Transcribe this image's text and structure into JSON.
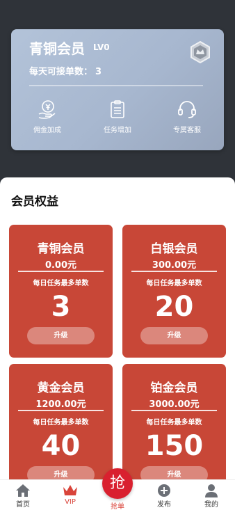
{
  "member": {
    "title": "青铜会员",
    "level": "LV0",
    "orders_label": "每天可接单数：",
    "orders_value": "3",
    "features": [
      {
        "icon": "coin-hand-icon",
        "label": "佣金加成"
      },
      {
        "icon": "clipboard-icon",
        "label": "任务增加"
      },
      {
        "icon": "headset-icon",
        "label": "专属客服"
      }
    ]
  },
  "benefits": {
    "title": "会员权益",
    "cap_label": "每日任务最多单数",
    "upgrade_label": "升级",
    "tiers": [
      {
        "name": "青铜会员",
        "price": "0.00元",
        "count": "3"
      },
      {
        "name": "白银会员",
        "price": "300.00元",
        "count": "20"
      },
      {
        "name": "黄金会员",
        "price": "1200.00元",
        "count": "40"
      },
      {
        "name": "铂金会员",
        "price": "3000.00元",
        "count": "150"
      }
    ]
  },
  "tabbar": {
    "home": "首页",
    "vip": "VIP",
    "grab_glyph": "抢",
    "grab": "抢单",
    "publish": "发布",
    "mine": "我的"
  },
  "colors": {
    "accent": "#c84737",
    "tab_active": "#d9443a",
    "grab": "#d9202f"
  }
}
